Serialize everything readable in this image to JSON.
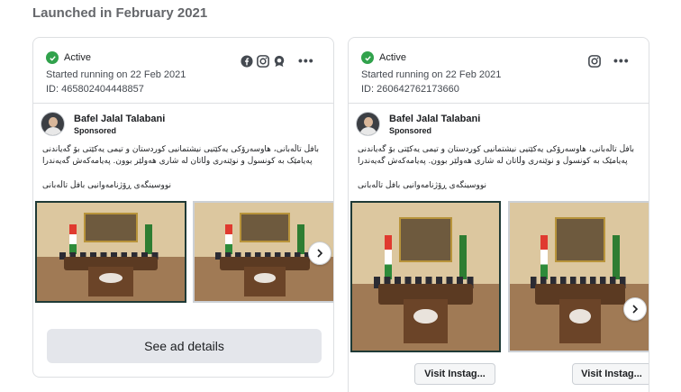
{
  "section_title": "Launched in February 2021",
  "colors": {
    "active_green": "#31a24c",
    "selected_border": "#1f3a36",
    "button_bg": "#e4e6eb"
  },
  "cards": [
    {
      "status": "Active",
      "started": "Started running on 22 Feb 2021",
      "id_text": "ID: 465802404448857",
      "platforms": [
        "facebook-icon",
        "instagram-icon",
        "audience-network-icon"
      ],
      "page_name": "Bafel Jalal Talabani",
      "sponsored": "Sponsored",
      "body_lines": [
        "بافڵ تاڵەبانی، هاوسەرۆکی یەکێتیی نیشتمانیی کوردستان و تیمی یەکێتی بۆ گەیاندنی",
        "پەیامێک بە کونسوڵ و نوێنەری وڵاتان لە شاری هەولێر بوون. پەیامەکەش گەیەندرا"
      ],
      "signature": "نووسینگەی ڕۆژنامەوانیی بافڵ تاڵەبانی",
      "cta": "See ad details"
    },
    {
      "status": "Active",
      "started": "Started running on 22 Feb 2021",
      "id_text": "ID: 260642762173660",
      "platforms": [
        "instagram-icon"
      ],
      "page_name": "Bafel Jalal Talabani",
      "sponsored": "Sponsored",
      "body_lines": [
        "بافڵ تاڵەبانی، هاوسەرۆکی یەکێتیی نیشتمانیی کوردستان و تیمی یەکێتی بۆ گەیاندنی",
        "پەیامێک بە کونسوڵ و نوێنەری وڵاتان لە شاری هەولێر بوون. پەیامەکەش گەیەندرا"
      ],
      "signature": "نووسینگەی ڕۆژنامەوانیی بافڵ تاڵەبانی",
      "visit_buttons": [
        "Visit Instag...",
        "Visit Instag..."
      ]
    }
  ]
}
